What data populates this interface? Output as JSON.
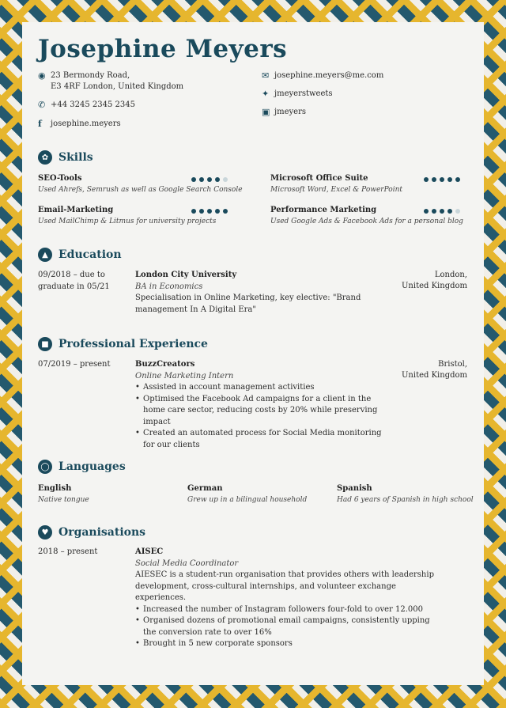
{
  "name": "Josephine Meyers",
  "contact": {
    "address_line1": "23 Bermondy Road,",
    "address_line2": "E3 4RF London, United Kingdom",
    "phone": "+44 3245 2345 2345",
    "facebook": "josephine.meyers",
    "email": "josephine.meyers@me.com",
    "twitter": "jmeyerstweets",
    "instagram": "jmeyers"
  },
  "sections": {
    "skills": "Skills",
    "education": "Education",
    "experience": "Professional Experience",
    "languages": "Languages",
    "organisations": "Organisations"
  },
  "skills": [
    {
      "name": "SEO-Tools",
      "desc": "Used Ahrefs, Semrush as well as Google Search Console",
      "level": 4
    },
    {
      "name": "Microsoft Office Suite",
      "desc": "Microsoft Word, Excel & PowerPoint",
      "level": 5
    },
    {
      "name": "Email-Marketing",
      "desc": "Used MailChimp & Litmus for university projects",
      "level": 5
    },
    {
      "name": "Performance Marketing",
      "desc": "Used Google Ads & Facebook Ads for a personal blog",
      "level": 4
    }
  ],
  "education": {
    "date1": "09/2018 – due to",
    "date2": "graduate in 05/21",
    "school": "London City University",
    "degree": "BA in Economics",
    "detail1": "Specialisation in Online Marketing, key elective: \"Brand",
    "detail2": "management In A Digital Era\"",
    "loc1": "London,",
    "loc2": "United Kingdom"
  },
  "experience": {
    "date": "07/2019 – present",
    "company": "BuzzCreators",
    "role": "Online Marketing Intern",
    "loc1": "Bristol,",
    "loc2": "United Kingdom",
    "bullets": [
      "Assisted in account management activities",
      "Optimised the Facebook Ad campaigns for a client in the home care sector, reducing costs by 20% while preserving impact",
      "Created an automated process for Social Media monitoring for our clients"
    ]
  },
  "languages": [
    {
      "name": "English",
      "desc": "Native tongue"
    },
    {
      "name": "German",
      "desc": "Grew up in a bilingual household"
    },
    {
      "name": "Spanish",
      "desc": "Had 6 years of Spanish in high school"
    }
  ],
  "organisation": {
    "date": "2018 – present",
    "name": "AISEC",
    "role": "Social Media Coordinator",
    "desc": "AIESEC is a student-run organisation that provides others with leadership development, cross-cultural internships, and volunteer exchange experiences.",
    "bullets": [
      "Increased the number of Instagram followers four-fold to over 12.000",
      "Organised dozens of promotional email campaigns, consistently upping the conversion rate to over 16%",
      "Brought in 5 new corporate sponsors"
    ]
  },
  "icons": {
    "address": "map-pin-icon",
    "phone": "phone-icon",
    "facebook": "facebook-icon",
    "email": "email-icon",
    "twitter": "twitter-icon",
    "instagram": "instagram-icon"
  },
  "colors": {
    "accent": "#1a4a5c",
    "tile_yellow": "#e6b62e"
  }
}
